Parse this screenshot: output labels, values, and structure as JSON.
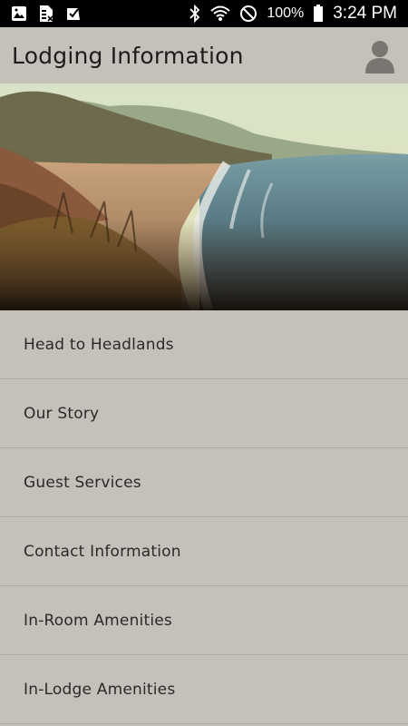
{
  "status_bar": {
    "battery_pct": "100%",
    "time": "3:24 PM",
    "icons": [
      "gallery-icon",
      "document-icon",
      "check-icon",
      "bluetooth-icon",
      "wifi-icon",
      "do-not-disturb-icon",
      "battery-icon"
    ]
  },
  "header": {
    "title": "Lodging Information",
    "avatar_icon": "person-icon"
  },
  "hero": {
    "description_icon": "coastal-landscape-image"
  },
  "menu": {
    "items": [
      {
        "label": "Head to Headlands"
      },
      {
        "label": "Our Story"
      },
      {
        "label": "Guest Services"
      },
      {
        "label": "Contact Information"
      },
      {
        "label": "In-Room Amenities"
      },
      {
        "label": "In-Lodge Amenities"
      }
    ]
  },
  "colors": {
    "status_bar_bg": "#000000",
    "app_bg": "#c5c0b9",
    "text": "#2a2a2a",
    "divider": "#aea9a2"
  }
}
